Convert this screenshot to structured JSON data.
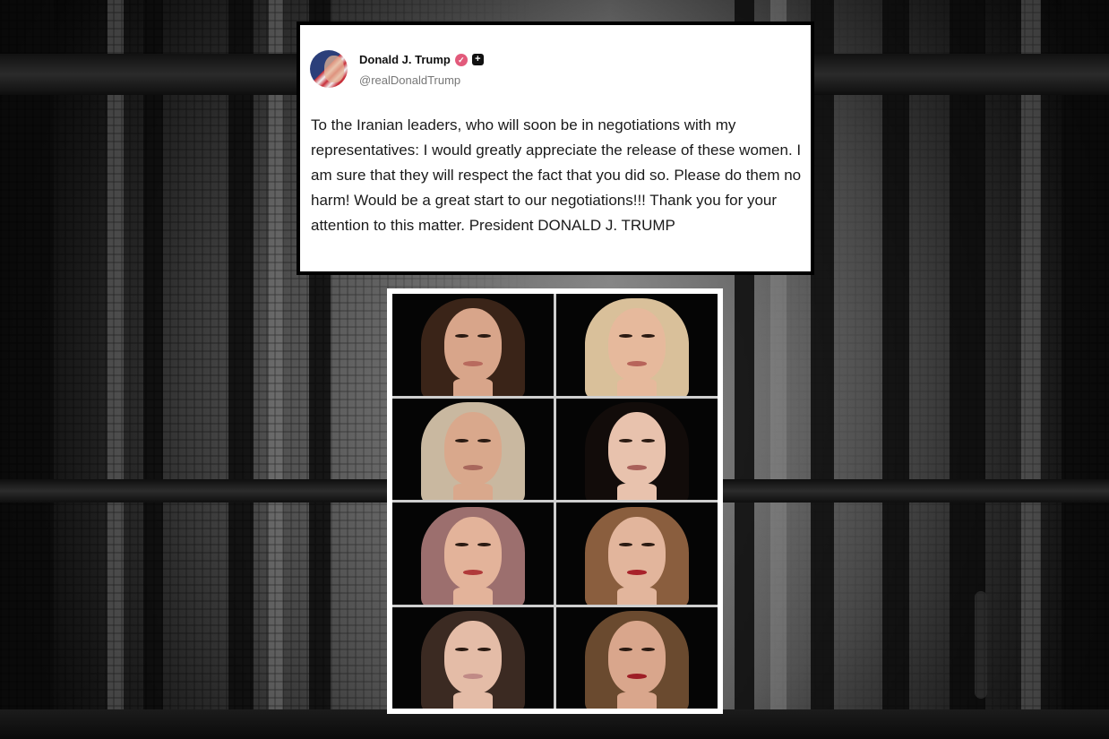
{
  "post": {
    "author_name": "Donald J. Trump",
    "author_handle": "@realDonaldTrump",
    "verified_icon": "check-badge-icon",
    "plus_icon": "plus-square-icon",
    "body": "To the Iranian leaders, who will soon be in negotiations with my representatives: I would greatly appreciate the release of these women. I am sure that they will respect the fact that you did so. Please do them no harm! Would be a great start to our negotiations!!! Thank you for your attention to this matter. President DONALD J. TRUMP"
  },
  "colors": {
    "card_background": "#ffffff",
    "card_border": "#000000",
    "verified_badge": "#e25a7b",
    "handle_text": "#777777"
  },
  "collage": {
    "portraits": [
      {
        "hair": "#3a2418",
        "skin": "#d8a58a",
        "lips": "#b86a5e"
      },
      {
        "hair": "#d9c09a",
        "skin": "#e6b99c",
        "lips": "#b7645a"
      },
      {
        "hair": "#c9b8a0",
        "skin": "#d9a88c",
        "lips": "#a8675c"
      },
      {
        "hair": "#120c0a",
        "skin": "#e8c2ad",
        "lips": "#a9605a"
      },
      {
        "hair": "#9c6f6e",
        "skin": "#e3b39a",
        "lips": "#b03a3a"
      },
      {
        "hair": "#8a5e3e",
        "skin": "#e2b59c",
        "lips": "#a8222a"
      },
      {
        "hair": "#3b2a22",
        "skin": "#e4bca7",
        "lips": "#c08a86"
      },
      {
        "hair": "#6a4a2f",
        "skin": "#d9a68c",
        "lips": "#9e1e26"
      }
    ]
  }
}
